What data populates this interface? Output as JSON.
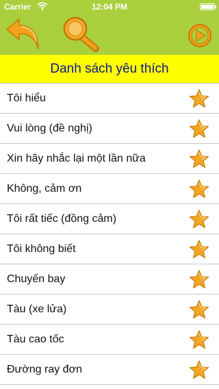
{
  "status": {
    "carrier": "Carrier",
    "time": "12:04 PM"
  },
  "colors": {
    "toolbar": "#a9cf3d",
    "title_bar": "#ffff00",
    "title_text": "#0a1790",
    "icon_orange": "#f0a020",
    "star": "#f4a623"
  },
  "toolbar": {
    "back_icon": "back-arrow-icon",
    "search_icon": "magnifier-icon",
    "play_icon": "play-circle-icon"
  },
  "title": "Danh sách yêu thích",
  "favorites": [
    {
      "label": "Tôi hiểu",
      "icon": "star-icon"
    },
    {
      "label": "Vui lòng (đề nghị)",
      "icon": "star-icon"
    },
    {
      "label": "Xin hãy nhắc lại một lần nữa",
      "icon": "star-icon"
    },
    {
      "label": "Không, cảm ơn",
      "icon": "star-icon"
    },
    {
      "label": "Tôi rất tiếc (đồng cảm)",
      "icon": "star-icon"
    },
    {
      "label": "Tôi không biết",
      "icon": "star-icon"
    },
    {
      "label": "Chuyến bay",
      "icon": "star-icon"
    },
    {
      "label": "Tàu (xe lửa)",
      "icon": "star-icon"
    },
    {
      "label": "Tàu cao tốc",
      "icon": "star-icon"
    },
    {
      "label": "Đường ray đơn",
      "icon": "star-icon"
    }
  ]
}
